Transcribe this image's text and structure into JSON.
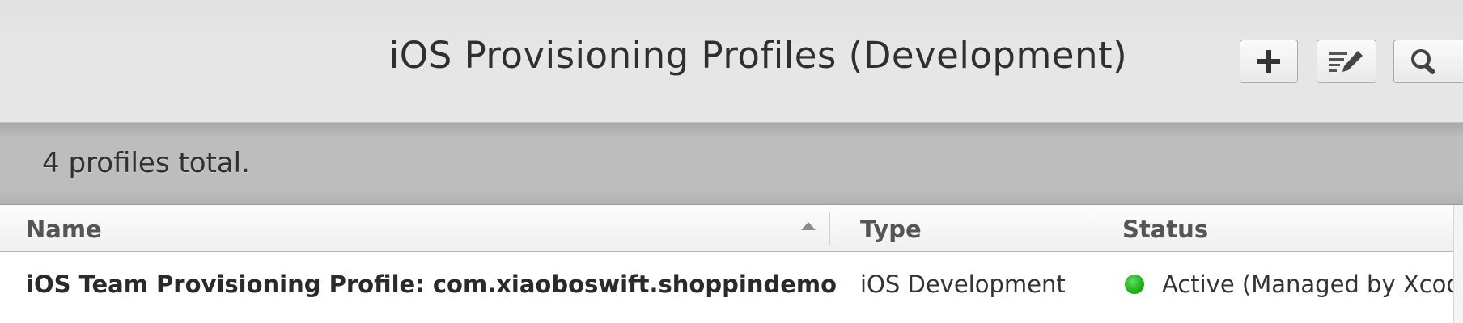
{
  "header": {
    "title": "iOS Provisioning Profiles (Development)",
    "buttons": [
      {
        "name": "add",
        "icon": "plus-icon"
      },
      {
        "name": "edit",
        "icon": "edit-list-icon"
      },
      {
        "name": "search",
        "icon": "search-icon"
      }
    ]
  },
  "summary": {
    "text": "4 profiles total."
  },
  "table": {
    "columns": [
      {
        "label": "Name",
        "sorted": "ascending"
      },
      {
        "label": "Type"
      },
      {
        "label": "Status"
      }
    ],
    "rows": [
      {
        "name": "iOS Team Provisioning Profile: com.xiaoboswift.shoppindemo",
        "type": "iOS Development",
        "status": "Active (Managed by Xcod",
        "status_color": "#1fb31f"
      }
    ]
  },
  "colors": {
    "header_bg": "#e6e6e6",
    "summary_bg": "#bdbdbd",
    "status_active": "#1fb31f"
  }
}
